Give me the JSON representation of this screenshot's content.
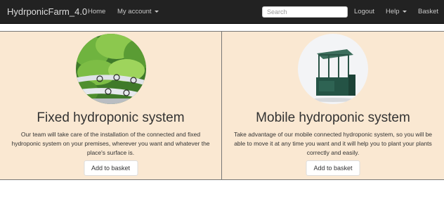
{
  "navbar": {
    "brand": "HydrponicFarm_4.0",
    "home": "Home",
    "my_account": "My account",
    "search_placeholder": "Search",
    "logout": "Logout",
    "help": "Help",
    "basket": "Basket"
  },
  "products": [
    {
      "image": "lettuce-hydroponic-rows-image",
      "title": "Fixed hydroponic system",
      "description": "Our team will take care of the installation of the connected and fixed hydroponic system on your premises, wherever you want and whatever the place's surface is.",
      "button": "Add to basket"
    },
    {
      "image": "mobile-hydroponic-cabinet-image",
      "title": "Mobile hydroponic system",
      "description": "Take advantage of our mobile connected hydroponic system, so you will be able to move it at any time you want and it will help you to plant your plants correctly and easily.",
      "button": "Add to basket"
    }
  ],
  "colors": {
    "navbar_bg": "#222222",
    "card_bg": "#fae8d2",
    "text": "#333333"
  }
}
